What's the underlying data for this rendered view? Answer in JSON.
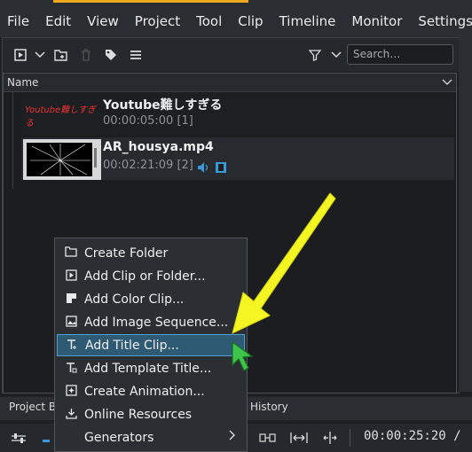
{
  "menubar": {
    "items": [
      "File",
      "Edit",
      "View",
      "Project",
      "Tool",
      "Clip",
      "Timeline",
      "Monitor",
      "Settings"
    ]
  },
  "toolbar": {
    "search_placeholder": "Search…"
  },
  "bin": {
    "column_name": "Name",
    "clips": [
      {
        "thumb_text": "Youtube難しすぎる",
        "name": "Youtube難しすぎる",
        "meta": "00:00:05:00 [1]"
      },
      {
        "name": "AR_housya.mp4",
        "meta": "00:02:21:09 [2]"
      }
    ]
  },
  "bottom": {
    "tab_project_bin": "Project Bi",
    "tab_history": "History",
    "timecode": "00:00:25:20 /"
  },
  "context_menu": {
    "items": [
      {
        "label": "Create Folder",
        "icon": "folder-plus-icon"
      },
      {
        "label": "Add Clip or Folder...",
        "icon": "add-clip-icon"
      },
      {
        "label": "Add Color Clip...",
        "icon": "color-clip-icon"
      },
      {
        "label": "Add Image Sequence...",
        "icon": "image-sequence-icon"
      },
      {
        "label": "Add Title Clip...",
        "icon": "title-clip-icon",
        "selected": true
      },
      {
        "label": "Add Template Title...",
        "icon": "template-title-icon"
      },
      {
        "label": "Create Animation...",
        "icon": "animation-icon"
      },
      {
        "label": "Online Resources",
        "icon": "download-icon"
      },
      {
        "label": "Generators",
        "icon": "",
        "submenu": true
      }
    ]
  },
  "colors": {
    "accent": "#f0a81c",
    "selection": "#2e5a74",
    "annotation_arrow": "#f5f523",
    "cursor": "#3ec44a"
  }
}
